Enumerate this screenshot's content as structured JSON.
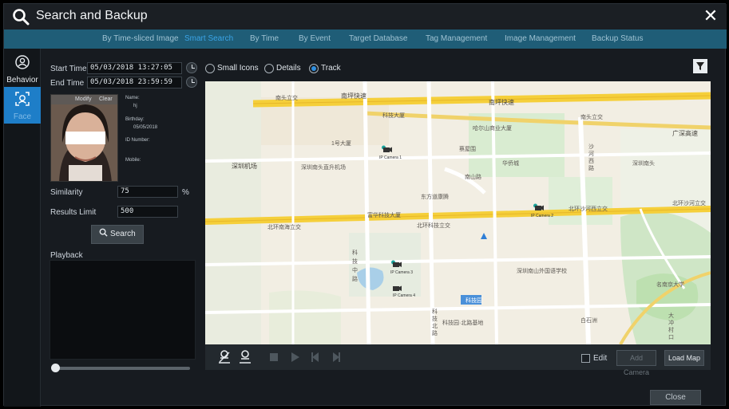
{
  "window": {
    "title": "Search and Backup",
    "close_icon": "close-icon",
    "search_icon": "search-icon"
  },
  "tabs": [
    {
      "label": "By Time-sliced Image",
      "active": false
    },
    {
      "label": "Smart Search",
      "active": true
    },
    {
      "label": "By Time",
      "active": false
    },
    {
      "label": "By Event",
      "active": false
    },
    {
      "label": "Target Database",
      "active": false
    },
    {
      "label": "Tag Management",
      "active": false
    },
    {
      "label": "Image Management",
      "active": false
    },
    {
      "label": "Backup Status",
      "active": false
    }
  ],
  "sidebar": {
    "items": [
      {
        "label": "Behavior",
        "icon": "behavior-icon",
        "active": false
      },
      {
        "label": "Face",
        "icon": "face-icon",
        "active": true
      }
    ]
  },
  "search": {
    "start_time_label": "Start Time",
    "start_time_value": "05/03/2018 13:27:05",
    "end_time_label": "End Time",
    "end_time_value": "05/03/2018 23:59:59",
    "similarity_label": "Similarity",
    "similarity_value": "75",
    "similarity_unit": "%",
    "results_limit_label": "Results Limit",
    "results_limit_value": "500",
    "search_button": "Search",
    "playback_label": "Playback"
  },
  "face_card": {
    "modify_label": "Modify",
    "clear_label": "Clear",
    "name_label": "Name:",
    "name_value": "hj",
    "birthday_label": "Birthday:",
    "birthday_value": "05/05/2018",
    "id_label": "ID Number:",
    "mobile_label": "Mobile:"
  },
  "view_modes": [
    {
      "label": "Small Icons",
      "selected": false
    },
    {
      "label": "Details",
      "selected": false
    },
    {
      "label": "Track",
      "selected": true
    }
  ],
  "map_controls": {
    "edit_label": "Edit",
    "add_camera_label": "Add Camera",
    "load_map_label": "Load Map"
  },
  "map_labels": [
    "南头立交",
    "南坪快速",
    "南坪快速",
    "南头立交",
    "广深高速",
    "科技大厦",
    "哈尔山商业大厦",
    "1号大厦",
    "深圳机场",
    "南山路",
    "蔡屋围",
    "华侨城",
    "深圳南头直升机场",
    "深圳南头",
    "东方道康腾",
    "富华科技大厦",
    "北环科技立交",
    "北环沙河西立交",
    "北环沙河立交",
    "北环南海立交",
    "科技中路",
    "科技园",
    "深圳南山外国语学校",
    "科技园·北路基地",
    "沙河西路",
    "名南京大学",
    "白石洲",
    "大冲村口",
    "科技北路"
  ],
  "cameras": [
    "IP Camera 1",
    "IP Camera 2",
    "IP Camera 3",
    "IP Camera 4"
  ],
  "footer": {
    "close_button": "Close"
  }
}
